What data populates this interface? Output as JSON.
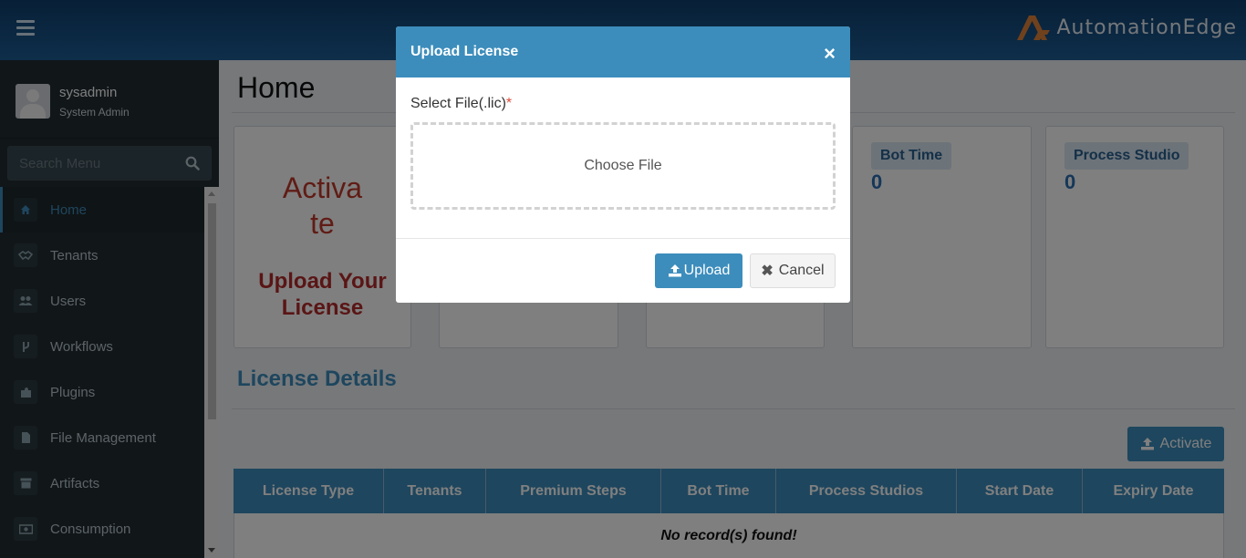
{
  "brand": {
    "name": "AutomationEdge",
    "logo": "automationedge-logo"
  },
  "user": {
    "name": "sysadmin",
    "role": "System Admin"
  },
  "search": {
    "placeholder": "Search Menu"
  },
  "sidebar": {
    "items": [
      {
        "label": "Home",
        "icon": "home-icon",
        "active": true
      },
      {
        "label": "Tenants",
        "icon": "handshake-icon"
      },
      {
        "label": "Users",
        "icon": "users-icon"
      },
      {
        "label": "Workflows",
        "icon": "code-fork-icon"
      },
      {
        "label": "Plugins",
        "icon": "puzzle-icon"
      },
      {
        "label": "File Management",
        "icon": "file-icon"
      },
      {
        "label": "Artifacts",
        "icon": "archive-icon"
      },
      {
        "label": "Consumption",
        "icon": "money-icon"
      }
    ]
  },
  "main": {
    "title": "Home",
    "activate_card": {
      "line1": "Activa",
      "line2": "te",
      "upload_text": "Upload Your License"
    },
    "stats": [
      {
        "label": "Bot Time",
        "value": "0"
      },
      {
        "label": "Process Studio",
        "value": "0"
      }
    ],
    "license_section": {
      "title": "License Details",
      "activate_button": "Activate",
      "columns": [
        "License Type",
        "Tenants",
        "Premium Steps",
        "Bot Time",
        "Process Studios",
        "Start Date",
        "Expiry Date"
      ],
      "empty_text": "No record(s) found!"
    }
  },
  "modal": {
    "title": "Upload License",
    "close": "×",
    "field_label": "Select File(.lic)",
    "required_mark": "*",
    "dropzone_text": "Choose File",
    "upload_button": "Upload",
    "cancel_button": "Cancel"
  },
  "colors": {
    "primary": "#3c8dbc",
    "sidebar": "#222d32",
    "danger": "#c0392b",
    "header": "#0f3f6e"
  }
}
